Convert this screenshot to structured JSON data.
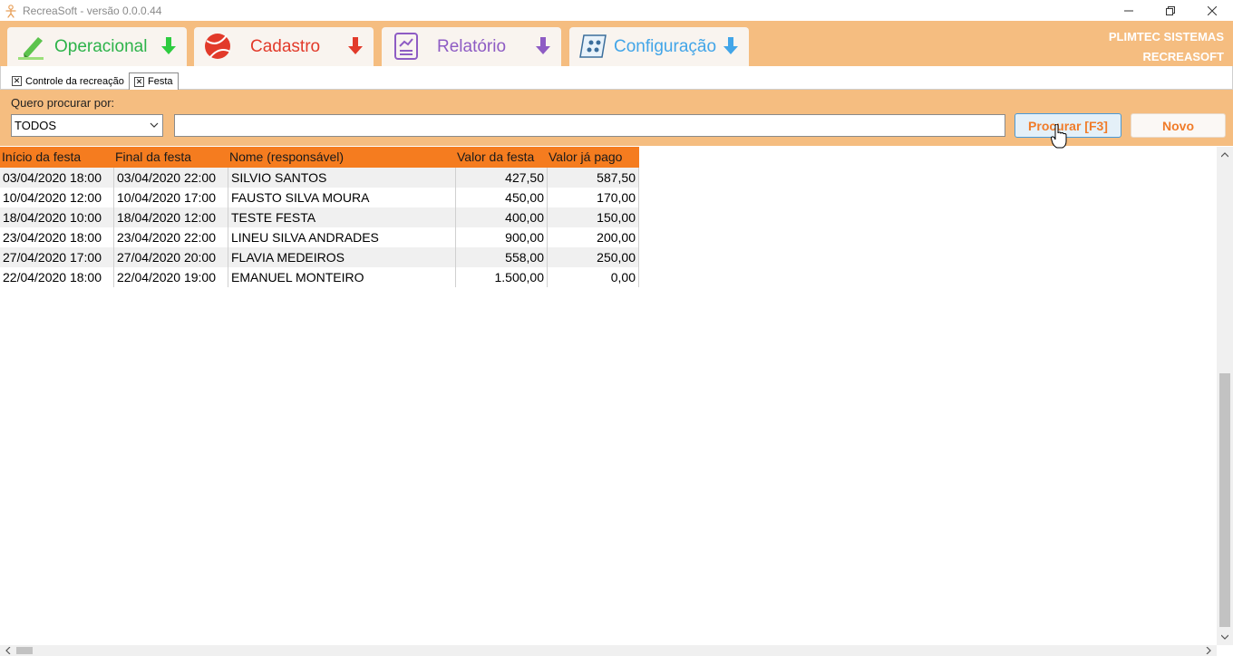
{
  "window": {
    "title": "RecreaSoft  -  versão 0.0.0.44",
    "controls": {
      "minimize": "minimize-icon",
      "maximize": "restore-icon",
      "close": "close-icon"
    }
  },
  "ribbon": {
    "tabs": [
      {
        "label": "Operacional",
        "color": "#2db34a",
        "icon": "highlighter-icon",
        "arrow_color": "#2ecc40"
      },
      {
        "label": "Cadastro",
        "color": "#e23a2a",
        "icon": "ball-icon",
        "arrow_color": "#e23a2a"
      },
      {
        "label": "Relatório",
        "color": "#8e5cc4",
        "icon": "report-icon",
        "arrow_color": "#8e5cc4"
      },
      {
        "label": "Configuração",
        "color": "#42a5e8",
        "icon": "settings-panel-icon",
        "arrow_color": "#42a5e8"
      }
    ],
    "brand_line1": "PLIMTEC SISTEMAS",
    "brand_line2": "RECREASOFT"
  },
  "doc_tabs": [
    {
      "label": "Controle da recreação",
      "active": false
    },
    {
      "label": "Festa",
      "active": true
    }
  ],
  "search": {
    "label": "Quero procurar por:",
    "filter_value": "TODOS",
    "query_value": "",
    "search_button": "Procurar [F3]",
    "new_button": "Novo"
  },
  "grid": {
    "columns": [
      "Início da festa",
      "Final da festa",
      "Nome (responsável)",
      "Valor da festa",
      "Valor já pago"
    ],
    "rows": [
      [
        "03/04/2020 18:00",
        "03/04/2020 22:00",
        "SILVIO SANTOS",
        "427,50",
        "587,50"
      ],
      [
        "10/04/2020 12:00",
        "10/04/2020 17:00",
        "FAUSTO SILVA MOURA",
        "450,00",
        "170,00"
      ],
      [
        "18/04/2020 10:00",
        "18/04/2020 12:00",
        "TESTE FESTA",
        "400,00",
        "150,00"
      ],
      [
        "23/04/2020 18:00",
        "23/04/2020 22:00",
        "LINEU SILVA ANDRADES",
        "900,00",
        "200,00"
      ],
      [
        "27/04/2020 17:00",
        "27/04/2020 20:00",
        "FLAVIA MEDEIROS",
        "558,00",
        "250,00"
      ],
      [
        "22/04/2020 18:00",
        "22/04/2020 19:00",
        "EMANUEL MONTEIRO",
        "1.500,00",
        "0,00"
      ]
    ]
  },
  "colors": {
    "ribbon_bg": "#f5bd80",
    "header_bg": "#f57c1f",
    "accent": "#f07c2a"
  }
}
